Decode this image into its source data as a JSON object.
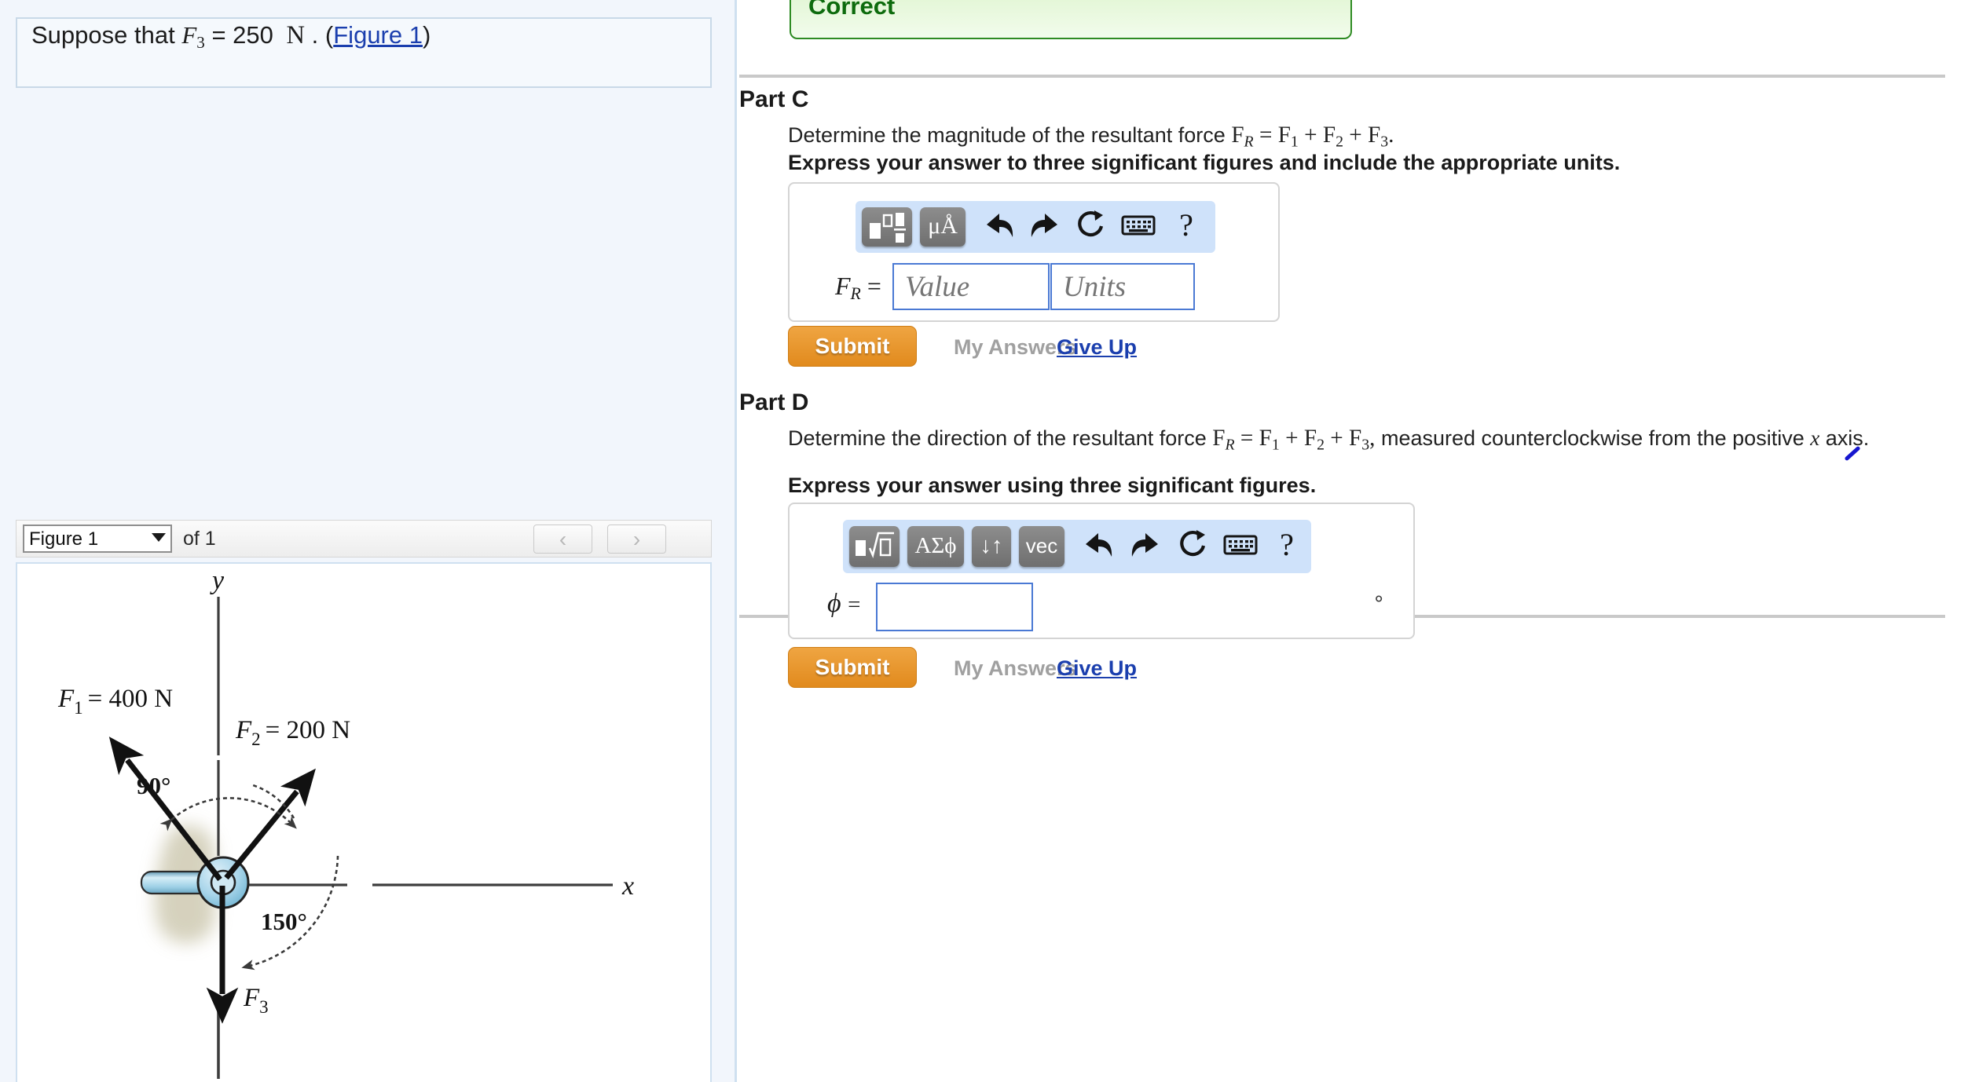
{
  "left_panel": {
    "problem_statement": {
      "prefix": "Suppose that",
      "symbol": "F",
      "symbol_sub": "3",
      "equals": "=",
      "value": "250",
      "unit": "N",
      "period": ".",
      "open_paren": "(",
      "figure_link": "Figure 1",
      "close_paren": ")"
    },
    "figure_nav": {
      "selected_figure": "Figure 1",
      "options": [
        "Figure 1"
      ],
      "of_label": "of 1",
      "prev_icon": "chevron-left-icon",
      "next_icon": "chevron-right-icon",
      "prev_glyph": "‹",
      "next_glyph": "›"
    }
  },
  "figure": {
    "axis_x_label": "x",
    "axis_y_label": "y",
    "force1_label": "F",
    "force1_sub": "1",
    "force1_value": "= 400 N",
    "force2_label": "F",
    "force2_sub": "2",
    "force2_value": "= 200 N",
    "force3_label": "F",
    "force3_sub": "3",
    "angle_90": "90°",
    "angle_150": "150°",
    "colors": {
      "collar_fill": "#a8d5ea",
      "collar_stroke": "#2b2b2b",
      "vector_stroke": "#111111",
      "shadow": "#cfcab2"
    }
  },
  "right_panel": {
    "correct_banner": {
      "label": "Correct",
      "text_color": "#0d6b0d",
      "border_color": "#2e8b23",
      "bg_color": "#ddf4cd"
    },
    "part_c": {
      "heading": "Part C",
      "question_prefix": "Determine the magnitude of the resultant force",
      "question_formula": {
        "fr": "F",
        "fr_sub": "R",
        "eq": "=",
        "t1": "F",
        "t1_sub": "1",
        "plus1": "+",
        "t2": "F",
        "t2_sub": "2",
        "plus2": "+",
        "t3": "F",
        "t3_sub": "3",
        "period": "."
      },
      "instruction": "Express your answer to three significant figures and include the appropriate units.",
      "toolbar": {
        "buttons": [
          {
            "name": "template-button",
            "glyph": "template"
          },
          {
            "name": "units-button",
            "glyph": "μÅ"
          }
        ],
        "icons": [
          {
            "name": "undo-icon",
            "glyph": "↶"
          },
          {
            "name": "redo-icon",
            "glyph": "↷"
          },
          {
            "name": "reset-icon",
            "glyph": "↻"
          },
          {
            "name": "keyboard-icon",
            "glyph": "keyboard"
          },
          {
            "name": "help-icon",
            "glyph": "?"
          }
        ]
      },
      "answer_label": "F",
      "answer_label_sub": "R",
      "answer_equals": "=",
      "value_placeholder": "Value",
      "units_placeholder": "Units",
      "value": "",
      "units": "",
      "submit_label": "Submit",
      "my_answers_label": "My Answers",
      "give_up_label": "Give Up"
    },
    "part_d": {
      "heading": "Part D",
      "question_prefix": "Determine the direction of the resultant force",
      "question_formula": {
        "fr": "F",
        "fr_sub": "R",
        "eq": "=",
        "t1": "F",
        "t1_sub": "1",
        "plus1": "+",
        "t2": "F",
        "t2_sub": "2",
        "plus2": "+",
        "t3": "F",
        "t3_sub": "3",
        "comma": ","
      },
      "question_suffix_1": "measured counterclockwise",
      "question_suffix_2_a": "from the positive",
      "question_suffix_2_x": "x",
      "question_suffix_2_b": "axis.",
      "instruction": "Express your answer using three significant figures.",
      "toolbar": {
        "buttons": [
          {
            "name": "template-button",
            "glyph": "radical"
          },
          {
            "name": "greek-symbols-button",
            "glyph": "ΑΣϕ"
          },
          {
            "name": "arrows-button",
            "glyph": "↓↑"
          },
          {
            "name": "vector-button",
            "glyph": "vec"
          }
        ],
        "icons": [
          {
            "name": "undo-icon",
            "glyph": "↶"
          },
          {
            "name": "redo-icon",
            "glyph": "↷"
          },
          {
            "name": "reset-icon",
            "glyph": "↻"
          },
          {
            "name": "keyboard-icon",
            "glyph": "keyboard"
          },
          {
            "name": "help-icon",
            "glyph": "?"
          }
        ]
      },
      "answer_label": "ϕ",
      "answer_equals": "=",
      "value": "",
      "degree_unit": "∘",
      "submit_label": "Submit",
      "my_answers_label": "My Answers",
      "give_up_label": "Give Up"
    }
  },
  "colors": {
    "accent_submit": "#e8902c",
    "link": "#1b3fae",
    "left_panel_bg": "#f2f6fc",
    "toolbar_bg": "#cfe2fa",
    "annotation_mark": "#1616cf"
  }
}
